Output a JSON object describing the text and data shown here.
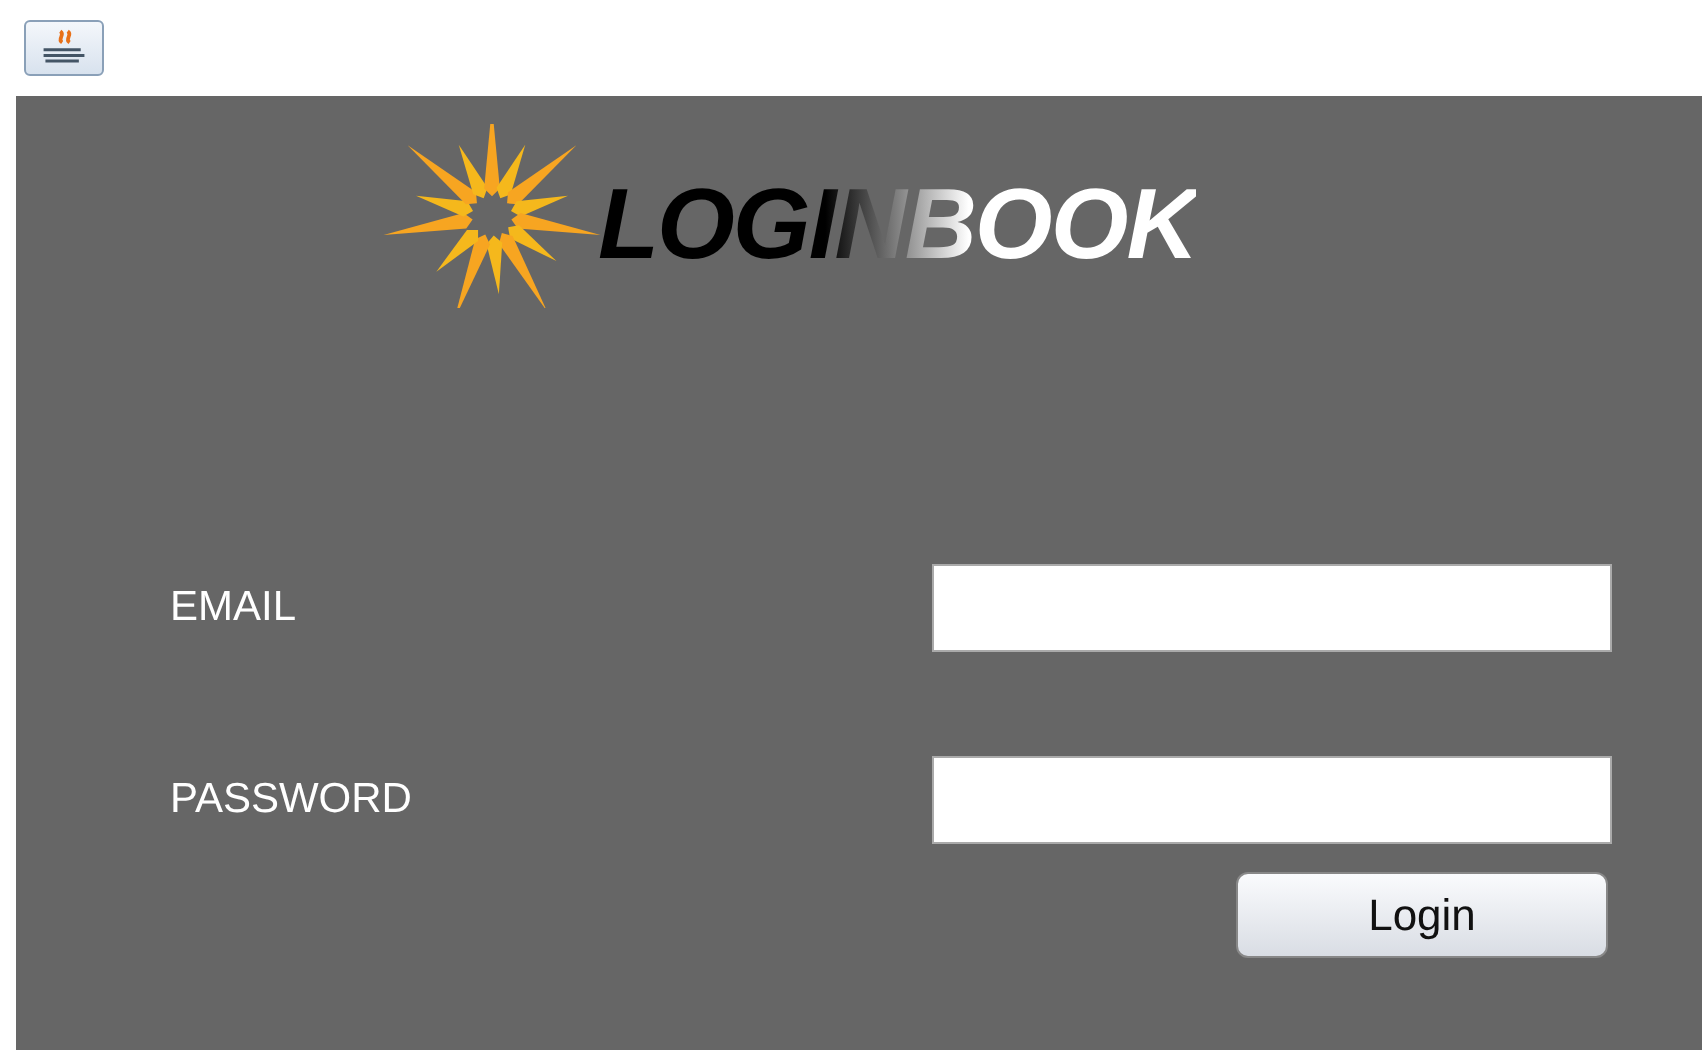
{
  "logo": {
    "text": "LOGINBOOK"
  },
  "fields": [
    {
      "label": "EMAIL"
    },
    {
      "label": "PASSWORD"
    }
  ],
  "button": {
    "label": "Login"
  }
}
